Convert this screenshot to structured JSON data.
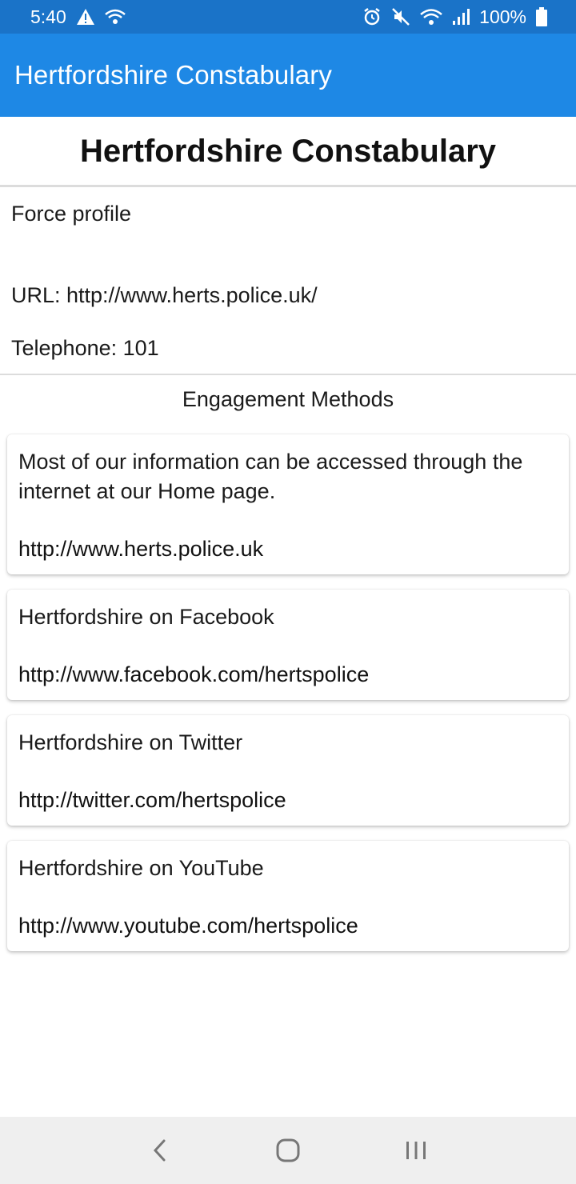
{
  "status_bar": {
    "time": "5:40",
    "battery": "100%",
    "icons": [
      "warning-icon",
      "wifi-icon",
      "alarm-icon",
      "mute-icon",
      "wifi-icon",
      "signal-icon",
      "battery-icon"
    ]
  },
  "app_bar": {
    "title": "Hertfordshire Constabulary"
  },
  "page": {
    "title": "Hertfordshire Constabulary"
  },
  "profile": {
    "heading": "Force profile",
    "url": "URL: http://www.herts.police.uk/",
    "telephone": "Telephone: 101"
  },
  "engagement": {
    "title": "Engagement Methods",
    "items": [
      {
        "description": "Most of our information can be accessed through the internet at our Home page.",
        "link": "http://www.herts.police.uk"
      },
      {
        "description": "Hertfordshire on Facebook",
        "link": "http://www.facebook.com/hertspolice"
      },
      {
        "description": "Hertfordshire on Twitter",
        "link": "http://twitter.com/hertspolice"
      },
      {
        "description": "Hertfordshire on YouTube",
        "link": "http://www.youtube.com/hertspolice"
      }
    ]
  },
  "nav": {
    "icons": [
      "back-icon",
      "home-icon",
      "recents-icon"
    ]
  },
  "colors": {
    "status_bar": "#1a73c8",
    "app_bar": "#1e88e5",
    "nav_bar": "#efefef"
  }
}
